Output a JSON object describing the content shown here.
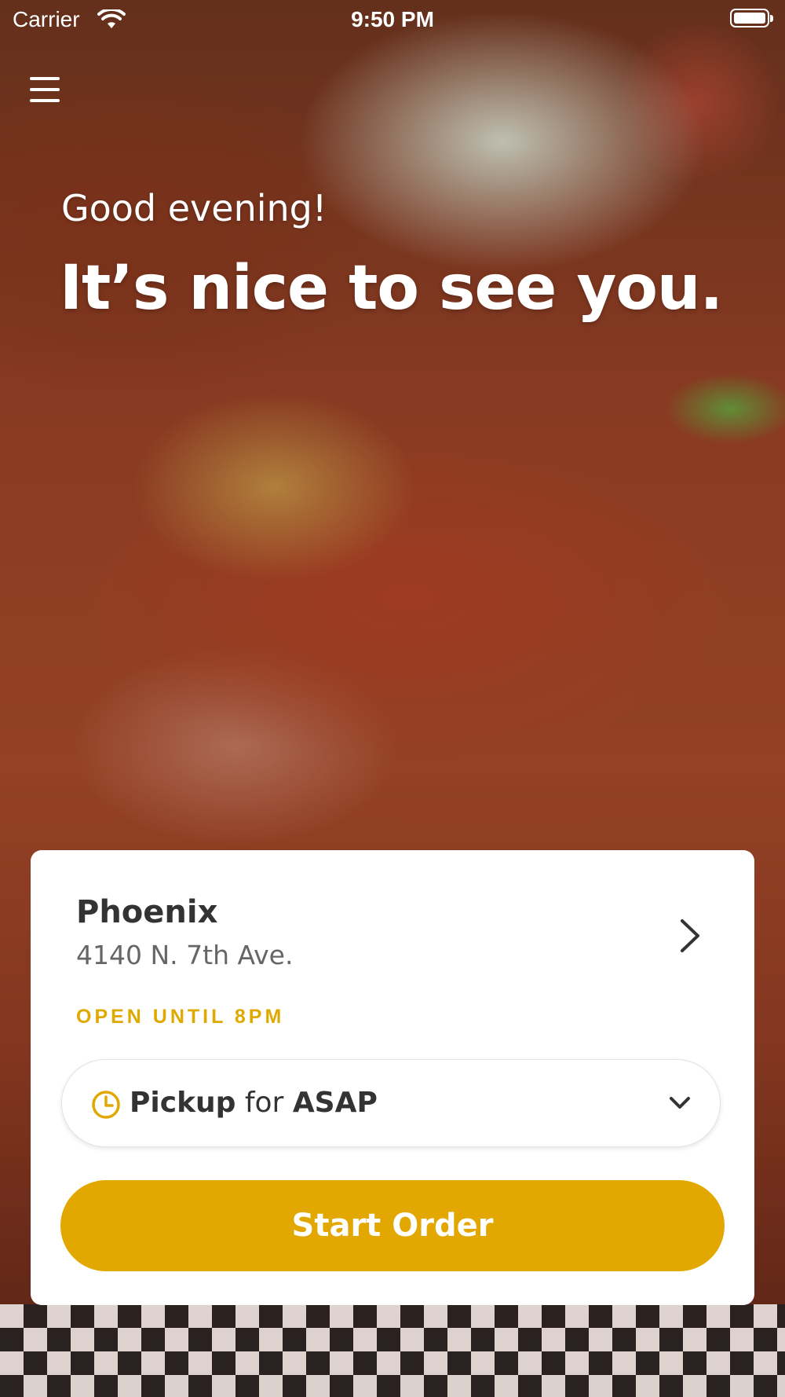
{
  "status_bar": {
    "carrier": "Carrier",
    "time": "9:50 PM"
  },
  "menu": {
    "icon": "hamburger-menu-icon"
  },
  "hero": {
    "greeting": "Good evening!",
    "headline": "It’s nice to see you."
  },
  "location": {
    "name": "Phoenix",
    "address": "4140 N. 7th Ave.",
    "hours": "OPEN UNTIL 8PM",
    "chevron_icon": "chevron-right-icon"
  },
  "order_type": {
    "icon": "clock-icon",
    "mode": "Pickup",
    "connector": "for",
    "time": "ASAP",
    "dropdown_icon": "chevron-down-icon"
  },
  "actions": {
    "start_order": "Start Order"
  },
  "colors": {
    "accent": "#e2a700",
    "hours_text": "#e0a900",
    "card_background": "#ffffff"
  }
}
